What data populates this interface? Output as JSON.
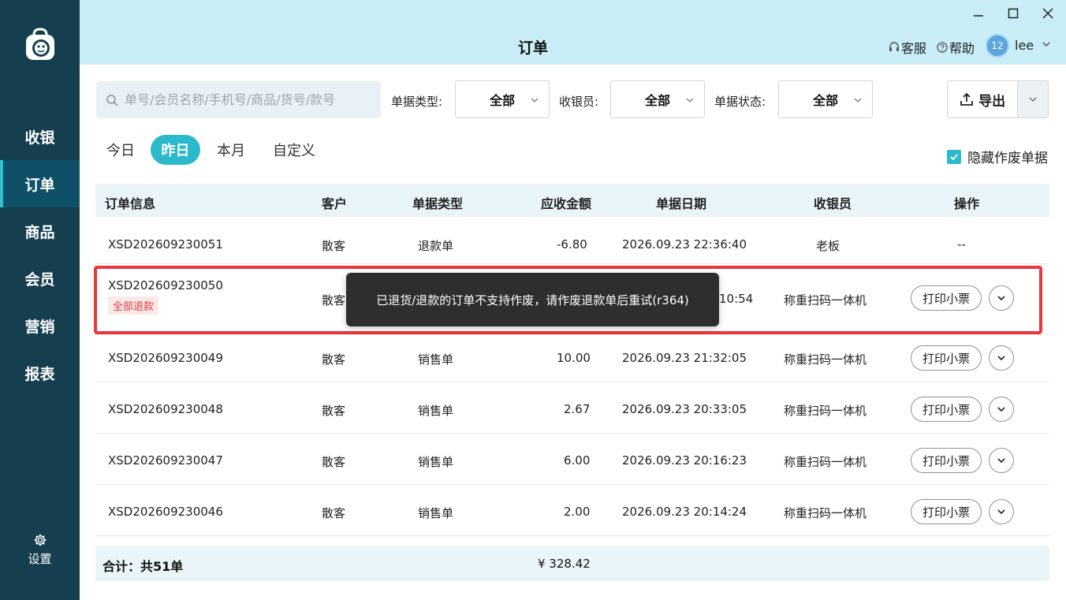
{
  "window": {
    "title": "订单"
  },
  "sidebar": {
    "items": [
      {
        "label": "收银"
      },
      {
        "label": "订单"
      },
      {
        "label": "商品"
      },
      {
        "label": "会员"
      },
      {
        "label": "营销"
      },
      {
        "label": "报表"
      }
    ],
    "active": "订单",
    "settings_label": "设置"
  },
  "header": {
    "service_label": "客服",
    "help_label": "帮助",
    "avatar_text": "12",
    "username": "lee"
  },
  "toolbar": {
    "search_placeholder": "单号/会员名称/手机号/商品/货号/款号",
    "type_label": "单据类型:",
    "type_value": "全部",
    "cashier_label": "收银员:",
    "cashier_value": "全部",
    "status_label": "单据状态:",
    "status_value": "全部",
    "export_label": "导出"
  },
  "date_tabs": [
    {
      "label": "今日"
    },
    {
      "label": "昨日"
    },
    {
      "label": "本月"
    },
    {
      "label": "自定义"
    }
  ],
  "active_tab": "昨日",
  "hide_void": {
    "label": "隐藏作废单据",
    "checked": true
  },
  "table": {
    "columns": [
      "订单信息",
      "客户",
      "单据类型",
      "应收金额",
      "单据日期",
      "收银员",
      "操作"
    ],
    "rows": [
      {
        "order_no": "XSD202609230051",
        "customer": "散客",
        "type": "退款单",
        "amount": "-6.80",
        "date": "2026.09.23 22:36:40",
        "cashier": "老板",
        "action": "--"
      },
      {
        "order_no": "XSD202609230050",
        "badge": "全部退款",
        "customer": "散客",
        "type": "",
        "amount": "",
        "date_partial": "10:54",
        "cashier": "称重扫码一体机",
        "print": "打印小票"
      },
      {
        "order_no": "XSD202609230049",
        "customer": "散客",
        "type": "销售单",
        "amount": "10.00",
        "date": "2026.09.23 21:32:05",
        "cashier": "称重扫码一体机",
        "print": "打印小票"
      },
      {
        "order_no": "XSD202609230048",
        "customer": "散客",
        "type": "销售单",
        "amount": "2.67",
        "date": "2026.09.23 20:33:05",
        "cashier": "称重扫码一体机",
        "print": "打印小票"
      },
      {
        "order_no": "XSD202609230047",
        "customer": "散客",
        "type": "销售单",
        "amount": "6.00",
        "date": "2026.09.23 20:16:23",
        "cashier": "称重扫码一体机",
        "print": "打印小票"
      },
      {
        "order_no": "XSD202609230046",
        "customer": "散客",
        "type": "销售单",
        "amount": "2.00",
        "date": "2026.09.23 20:14:24",
        "cashier": "称重扫码一体机",
        "print": "打印小票"
      }
    ],
    "footer_label": "合计：共51单",
    "footer_amount": "¥  328.42"
  },
  "toast": {
    "message": "已退货/退款的订单不支持作废，请作废退款单后重试(r364)"
  },
  "colors": {
    "sidebar": "#153f4f",
    "header": "#c9eef7",
    "accent": "#2bbacb",
    "highlight": "#e8383d"
  }
}
